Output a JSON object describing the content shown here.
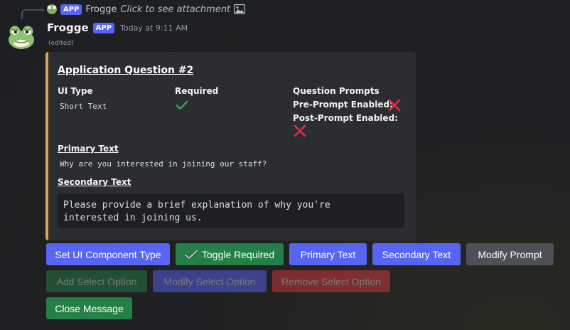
{
  "reply": {
    "app_badge": "APP",
    "author": "Frogge",
    "text": "Click to see attachment"
  },
  "message": {
    "author": "Frogge",
    "app_badge": "APP",
    "timestamp": "Today at 9:11 AM",
    "edited": "(edited)"
  },
  "embed": {
    "accent_color": "#e1a54c",
    "title": "Application Question #2",
    "fields": {
      "ui_type_name": "UI Type",
      "ui_type_value": "Short Text",
      "required_name": "Required",
      "prompts_name": "Question Prompts",
      "pre_prompt_label": "Pre-Prompt Enabled:",
      "post_prompt_label": "Post-Prompt Enabled:"
    },
    "primary_text_label": "Primary Text",
    "primary_text_value": "Why are you interested in joining our staff?",
    "secondary_text_label": "Secondary Text",
    "secondary_text_value": "Please provide a brief explanation of why you're\ninterested in joining us."
  },
  "buttons": {
    "row1": [
      {
        "label": "Set UI Component Type",
        "style": "primary"
      },
      {
        "label": "Toggle Required",
        "style": "success"
      },
      {
        "label": "Primary Text",
        "style": "primary"
      },
      {
        "label": "Secondary Text",
        "style": "primary"
      },
      {
        "label": "Modify Prompt",
        "style": "secondary"
      }
    ],
    "row2": [
      {
        "label": "Add Select Option",
        "style": "success",
        "disabled": true
      },
      {
        "label": "Modify Select Option",
        "style": "primary",
        "disabled": true
      },
      {
        "label": "Remove Select Option",
        "style": "danger",
        "disabled": true
      }
    ],
    "row3": [
      {
        "label": "Close Message",
        "style": "success"
      }
    ]
  },
  "colors": {
    "blurple": "#5865f2",
    "green": "#248046",
    "grey": "#4e5058",
    "red": "#da373c",
    "check_green": "#3ba55c",
    "cross_red": "#dd2e44"
  }
}
